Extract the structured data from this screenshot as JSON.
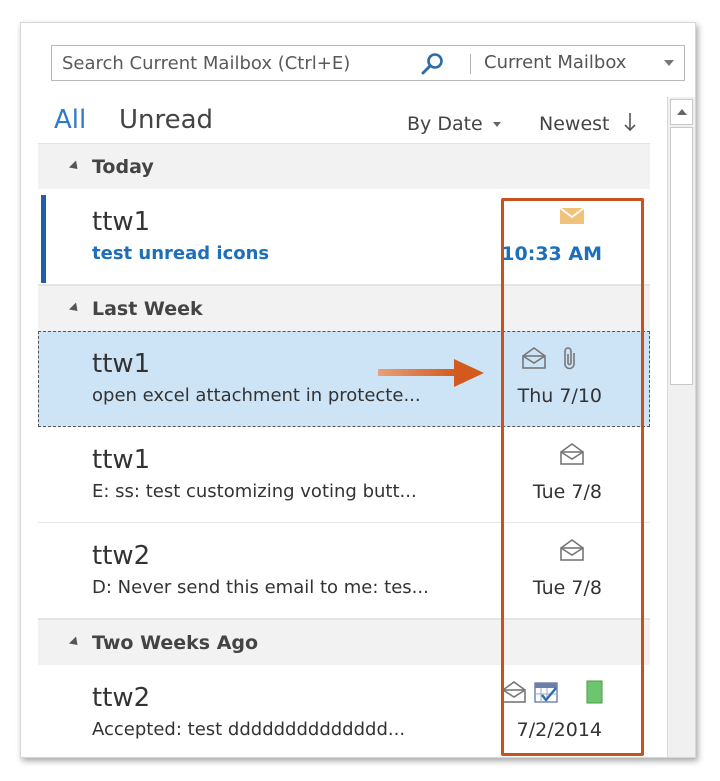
{
  "search": {
    "placeholder": "Search Current Mailbox (Ctrl+E)",
    "scope": "Current Mailbox"
  },
  "filters": {
    "all": "All",
    "unread": "Unread",
    "sort_by": "By Date",
    "sort_order": "Newest"
  },
  "groups": [
    {
      "label": "Today",
      "items": [
        {
          "sender": "ttw1",
          "subject": "test unread icons",
          "date": "10:33 AM",
          "unread": true,
          "icons": [
            "closed-envelope-icon"
          ]
        }
      ]
    },
    {
      "label": "Last Week",
      "items": [
        {
          "sender": "ttw1",
          "subject": "open excel attachment in protecte...",
          "date": "Thu 7/10",
          "selected": true,
          "icons": [
            "open-envelope-icon",
            "paperclip-icon"
          ]
        },
        {
          "sender": "ttw1",
          "subject": "E: ss: test customizing voting butt...",
          "date": "Tue 7/8",
          "icons": [
            "open-envelope-icon"
          ]
        },
        {
          "sender": "ttw2",
          "subject": "D: Never send this email to me: tes...",
          "date": "Tue 7/8",
          "icons": [
            "open-envelope-icon"
          ]
        }
      ]
    },
    {
      "label": "Two Weeks Ago",
      "items": [
        {
          "sender": "ttw2",
          "subject": "Accepted: test dddddddddddddd...",
          "date": "7/2/2014",
          "icons": [
            "open-envelope-icon",
            "calendar-check-icon",
            "green-category-icon"
          ]
        }
      ]
    }
  ],
  "colors": {
    "accent": "#2e7bc2",
    "unread_text": "#1e6fba",
    "unread_bar": "#1e5fa8",
    "selected_bg": "#cde4f7",
    "annotation": "#c8511d",
    "closed_envelope": "#f2c27a",
    "category_green": "#6cc66c"
  }
}
